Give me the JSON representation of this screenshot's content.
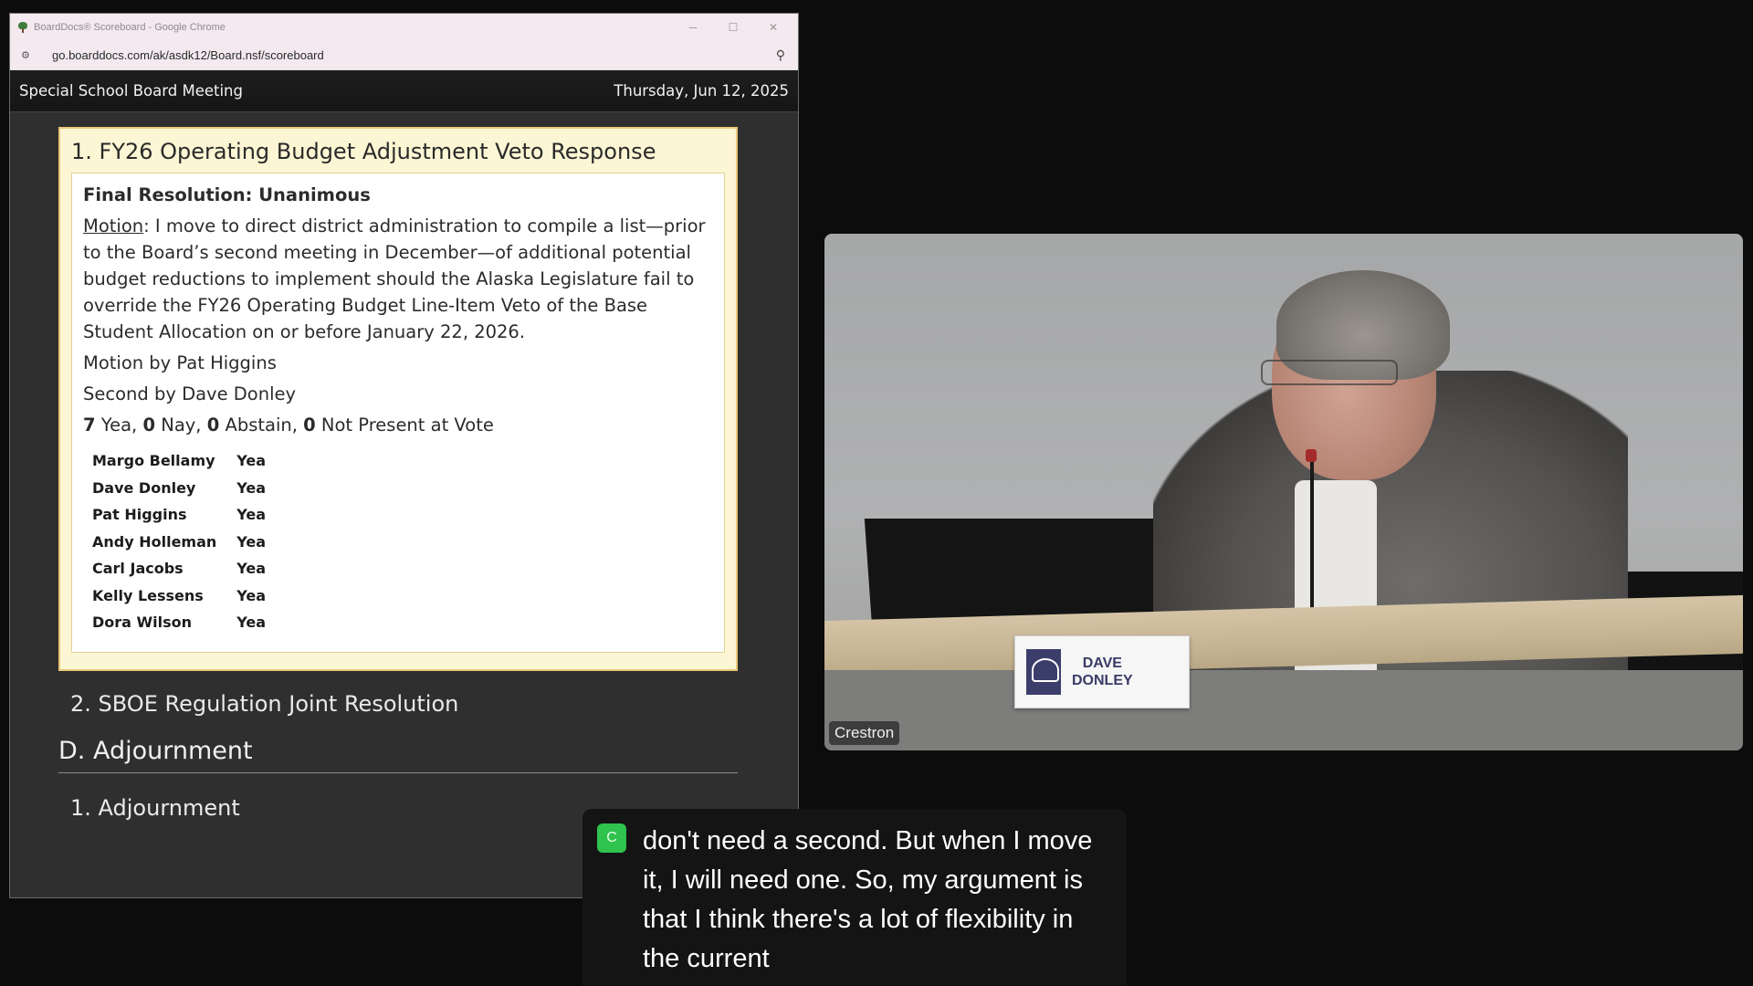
{
  "browser": {
    "window_title": "BoardDocs® Scoreboard - Google Chrome",
    "url": "go.boarddocs.com/ak/asdk12/Board.nsf/scoreboard",
    "controls": {
      "minimize": "─",
      "maximize": "☐",
      "close": "✕"
    }
  },
  "header": {
    "meeting_title": "Special School Board Meeting",
    "date": "Thursday, Jun 12, 2025"
  },
  "current_item": {
    "title": "1. FY26 Operating Budget Adjustment Veto Response",
    "resolution_heading": "Final Resolution: Unanimous",
    "motion_label": "Motion",
    "motion_text": ": I move to direct district administration to compile a list—prior to the Board’s second meeting in December—of additional potential budget reductions to implement should the Alaska Legislature fail to override the FY26 Operating Budget Line-Item Veto of the Base Student Allocation on or before January 22, 2026.",
    "motion_by": "Motion by Pat Higgins",
    "second_by": "Second by Dave Donley",
    "vote_summary": {
      "yea": "7",
      "yea_label": " Yea, ",
      "nay": "0",
      "nay_label": " Nay, ",
      "abstain": "0",
      "abstain_label": " Abstain, ",
      "not_present": "0",
      "not_present_label": " Not Present at Vote"
    },
    "votes": [
      {
        "name": "Margo Bellamy",
        "vote": "Yea"
      },
      {
        "name": "Dave Donley",
        "vote": "Yea"
      },
      {
        "name": "Pat Higgins",
        "vote": "Yea"
      },
      {
        "name": "Andy Holleman",
        "vote": "Yea"
      },
      {
        "name": "Carl Jacobs",
        "vote": "Yea"
      },
      {
        "name": "Kelly Lessens",
        "vote": "Yea"
      },
      {
        "name": "Dora Wilson",
        "vote": "Yea"
      }
    ]
  },
  "agenda": {
    "item_2": "2. SBOE Regulation Joint Resolution",
    "section_d": "D. Adjournment",
    "section_d_item_1": "1. Adjournment"
  },
  "video": {
    "nameplate_line1": "DAVE",
    "nameplate_line2": "DONLEY",
    "source_label": "Crestron"
  },
  "captions": {
    "avatar_letter": "C",
    "avatar_color": "#2fc24d",
    "text": "don't need a second. But when I move it, I will need one. So, my argument is that I think there's a lot of flexibility in the current"
  }
}
